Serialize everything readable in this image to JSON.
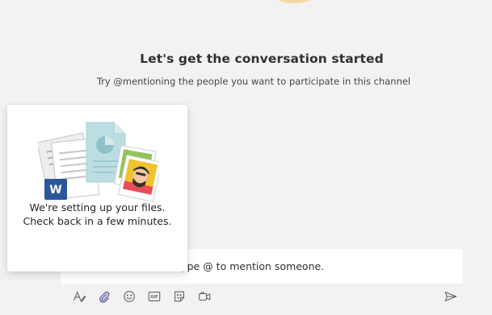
{
  "empty_state": {
    "title": "Let's get the conversation started",
    "subtitle": "Try @mentioning the people you want to participate in this channel"
  },
  "files_flyout": {
    "message_line1": "We're setting up your files.",
    "message_line2": "Check back in a few minutes."
  },
  "composer": {
    "placeholder": "on. Type @ to mention someone."
  },
  "toolbar": {
    "buttons": [
      {
        "icon": "format-text-icon"
      },
      {
        "icon": "attach-icon"
      },
      {
        "icon": "emoji-icon"
      },
      {
        "icon": "gif-icon",
        "text": "GIF"
      },
      {
        "icon": "sticker-icon"
      },
      {
        "icon": "meet-now-icon"
      }
    ],
    "send_icon": "send-icon"
  },
  "colors": {
    "background": "#f3f2f1",
    "panel": "#ffffff",
    "text": "#252423",
    "icon": "#616161",
    "attach_accent": "#6264a7",
    "word_blue": "#2b579a",
    "doc_teal": "#bcdde2"
  }
}
